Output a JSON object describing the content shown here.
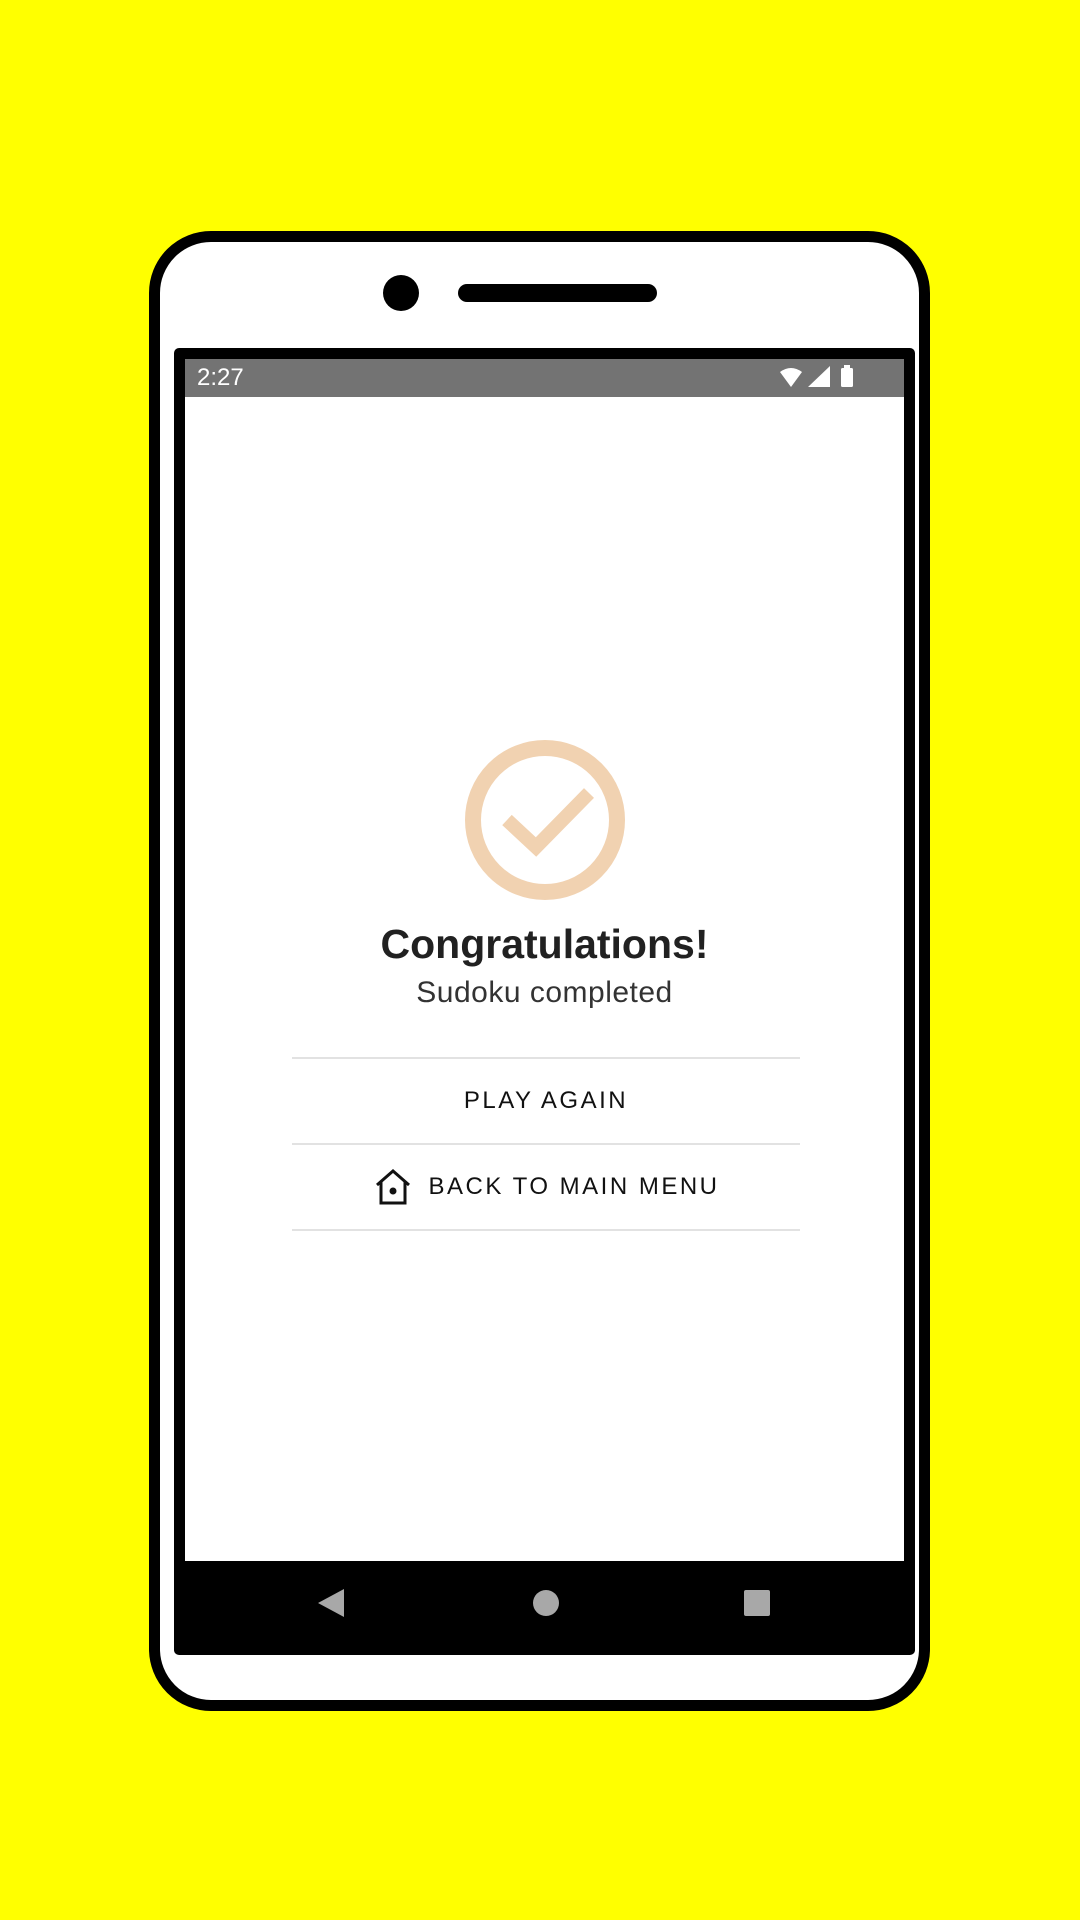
{
  "colors": {
    "background": "#ffff00",
    "status_bar": "#737373",
    "success_accent": "#f1d2b1",
    "nav_icons": "#a8a8a8"
  },
  "status_bar": {
    "time": "2:27",
    "icons": [
      "wifi-icon",
      "cell-signal-icon",
      "battery-icon"
    ]
  },
  "completion": {
    "icon": "check-circle-icon",
    "title": "Congratulations!",
    "subtitle": "Sudoku completed"
  },
  "actions": {
    "play_again_label": "PLAY AGAIN",
    "main_menu_label": "BACK TO MAIN MENU",
    "main_menu_icon": "home-icon"
  },
  "navigation": {
    "icons": [
      "back-icon",
      "home-circle-icon",
      "recents-icon"
    ]
  }
}
